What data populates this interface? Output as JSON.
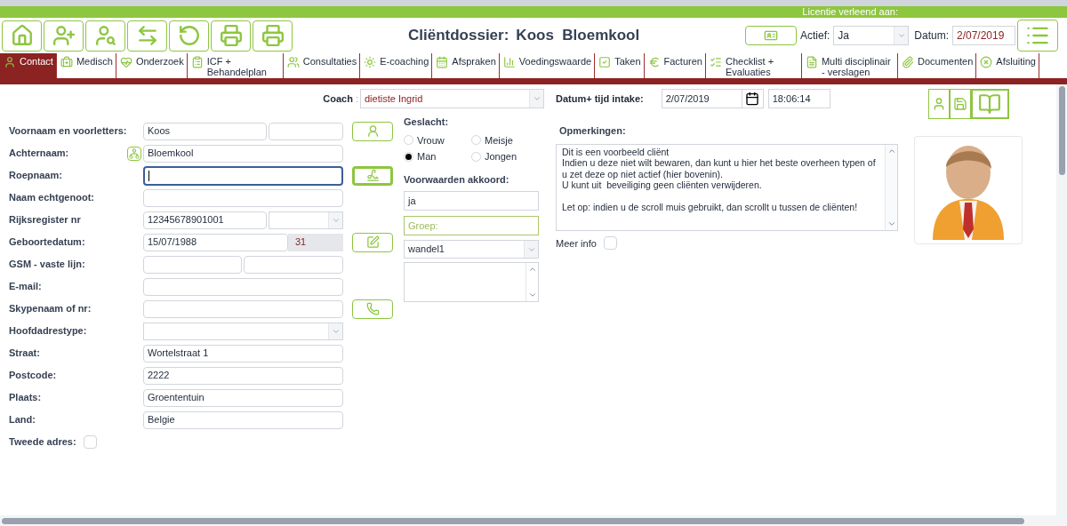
{
  "license_bar": {
    "text": "Licentie verleend aan:"
  },
  "header": {
    "title": "Cliëntdossier:",
    "client": "Koos  Bloemkool",
    "actief": {
      "label": "Actief:",
      "value": "Ja"
    },
    "datum": {
      "label": "Datum:",
      "value": "2/07/2019"
    }
  },
  "tabs": [
    {
      "label": "Contact",
      "selected": true
    },
    {
      "label": "Medisch",
      "selected": false
    },
    {
      "label": "Onderzoek",
      "selected": false
    },
    {
      "label": "ICF + Behandelplan",
      "selected": false
    },
    {
      "label": "Consultaties",
      "selected": false
    },
    {
      "label": "E-coaching",
      "selected": false
    },
    {
      "label": "Afspraken",
      "selected": false
    },
    {
      "label": "Voedingswaarde",
      "selected": false
    },
    {
      "label": "Taken",
      "selected": false
    },
    {
      "label": "Facturen",
      "selected": false
    },
    {
      "label": "Checklist + Evaluaties",
      "selected": false
    },
    {
      "label": "Multi disciplinair - verslagen",
      "selected": false
    },
    {
      "label": "Documenten",
      "selected": false
    },
    {
      "label": "Afsluiting",
      "selected": false
    }
  ],
  "coach": {
    "label": "Coach",
    "separator": ":",
    "value": "dietiste Ingrid"
  },
  "intake": {
    "label": "Datum+ tijd intake:",
    "date": "2/07/2019",
    "time": "18:06:14"
  },
  "fields": [
    {
      "label": "Voornaam en voorletters:",
      "kind": "split",
      "value": "Koos"
    },
    {
      "label": "Achternaam:",
      "kind": "text",
      "value": "Bloemkool"
    },
    {
      "label": "Roepnaam:",
      "kind": "text",
      "focused": true
    },
    {
      "label": "Naam echtgenoot:",
      "kind": "text",
      "focused": false
    },
    {
      "label": "Rijksregister nr",
      "kind": "text-select",
      "value": "12345678901001"
    },
    {
      "label": "Geboortedatum:",
      "kind": "date-age",
      "value": "15/07/1988",
      "value2": "31"
    },
    {
      "label": "GSM -  vaste lijn:",
      "kind": "halves"
    },
    {
      "label": "E-mail:",
      "kind": "text",
      "focused": false
    },
    {
      "label": "Skypenaam of nr:",
      "kind": "text",
      "focused": false
    },
    {
      "label": "Hoofdadrestype:",
      "kind": "select"
    },
    {
      "label": "Straat:",
      "kind": "text",
      "value": "Wortelstraat 1"
    },
    {
      "label": "Postcode:",
      "kind": "text",
      "value": "2222"
    },
    {
      "label": "Plaats:",
      "kind": "text",
      "value": "Groententuin"
    },
    {
      "label": "Land:",
      "kind": "text",
      "value": "Belgie"
    },
    {
      "label": "Tweede adres:",
      "kind": "checkbox",
      "checked": false
    }
  ],
  "gender": {
    "label": "Geslacht:",
    "options": [
      {
        "label": "Vrouw",
        "selected": false
      },
      {
        "label": "Meisje",
        "selected": false
      },
      {
        "label": "Man",
        "selected": true
      },
      {
        "label": "Jongen",
        "selected": false
      }
    ]
  },
  "voorwaarden": {
    "label": "Voorwaarden akkoord:",
    "value": "ja"
  },
  "groep": {
    "placeholder": "Groep:",
    "select": "wandel1"
  },
  "opmerkingen": {
    "label": "Opmerkingen:",
    "text": "Dit is een voorbeeld cliënt\nIndien u deze niet wilt bewaren, dan kunt u hier het beste overheen typen of u zet deze op niet actief (hier bovenin).\nU kunt uit  beveiliging geen cliënten verwijderen.\n\nLet op: indien u de scroll muis gebruikt, dan scrollt u tussen de cliënten!"
  },
  "meer_info": {
    "label": "Meer info",
    "checked": false
  }
}
